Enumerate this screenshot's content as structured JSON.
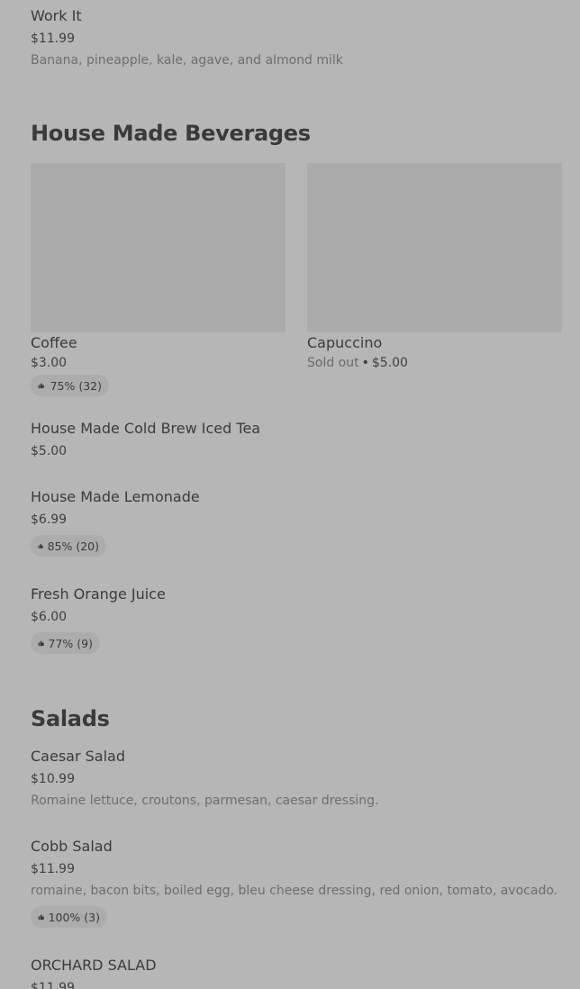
{
  "items_top": {
    "work_it": {
      "name": "Work It",
      "price": "$11.99",
      "description": "Banana, pineapple, kale, agave, and almond milk"
    }
  },
  "sections": {
    "beverages": {
      "title": "House Made Beverages",
      "cards": [
        {
          "name": "Coffee",
          "price": "$3.00",
          "rating": "75% (32)"
        },
        {
          "name": "Capuccino",
          "sold_out": "Sold out",
          "separator": "•",
          "price": "$5.00"
        }
      ],
      "items": [
        {
          "name": "House Made Cold Brew Iced Tea",
          "price": "$5.00"
        },
        {
          "name": "House Made Lemonade",
          "price": "$6.99",
          "rating": "85% (20)"
        },
        {
          "name": "Fresh Orange Juice",
          "price": "$6.00",
          "rating": "77% (9)"
        }
      ]
    },
    "salads": {
      "title": "Salads",
      "items": [
        {
          "name": "Caesar Salad",
          "price": "$10.99",
          "description": "Romaine lettuce, croutons, parmesan, caesar dressing."
        },
        {
          "name": "Cobb Salad",
          "price": "$11.99",
          "description": "romaine, bacon bits, boiled egg, bleu cheese dressing, red onion, tomato, avocado.",
          "rating": "100% (3)"
        },
        {
          "name": "ORCHARD SALAD",
          "price": "$11.99"
        }
      ]
    }
  },
  "icons": {
    "rating": "thumbs-up-icon"
  },
  "colors": {
    "overlay_background": "#b6b6b6",
    "image_placeholder": "#ababab",
    "badge_background": "#acacac"
  }
}
